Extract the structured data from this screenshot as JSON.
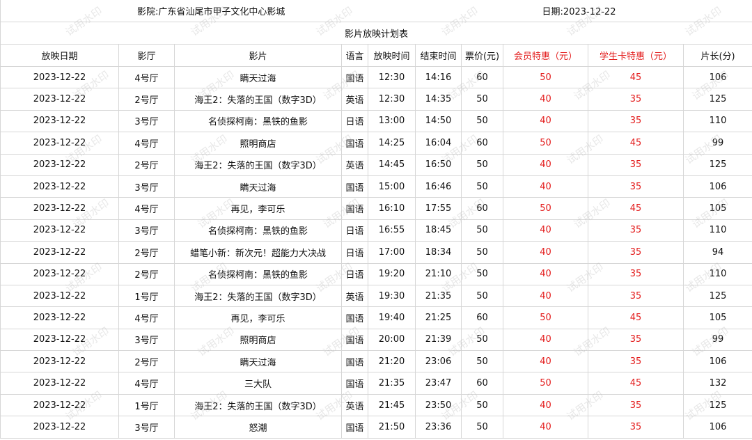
{
  "header": {
    "cinema": "影院:广东省汕尾市甲子文化中心影城",
    "date": "日期:2023-12-22",
    "subtitle": "影片放映计划表"
  },
  "columns": [
    "放映日期",
    "影厅",
    "影片",
    "语言",
    "放映时间",
    "结束时间",
    "票价(元)",
    "会员特惠（元）",
    "学生卡特惠（元）",
    "片长(分)"
  ],
  "highlight_color": "#e31b1b",
  "watermark": "试用水印",
  "rows": [
    [
      "2023-12-22",
      "4号厅",
      "瞒天过海",
      "国语",
      "12:30",
      "14:16",
      "60",
      "50",
      "45",
      "106"
    ],
    [
      "2023-12-22",
      "2号厅",
      "海王2：失落的王国（数字3D）",
      "英语",
      "12:30",
      "14:35",
      "50",
      "40",
      "35",
      "125"
    ],
    [
      "2023-12-22",
      "3号厅",
      "名侦探柯南：黑铁的鱼影",
      "日语",
      "13:00",
      "14:50",
      "50",
      "40",
      "35",
      "110"
    ],
    [
      "2023-12-22",
      "4号厅",
      "照明商店",
      "国语",
      "14:25",
      "16:04",
      "60",
      "50",
      "45",
      "99"
    ],
    [
      "2023-12-22",
      "2号厅",
      "海王2：失落的王国（数字3D）",
      "英语",
      "14:45",
      "16:50",
      "50",
      "40",
      "35",
      "125"
    ],
    [
      "2023-12-22",
      "3号厅",
      "瞒天过海",
      "国语",
      "15:00",
      "16:46",
      "50",
      "40",
      "35",
      "106"
    ],
    [
      "2023-12-22",
      "4号厅",
      "再见，李可乐",
      "国语",
      "16:10",
      "17:55",
      "60",
      "50",
      "45",
      "105"
    ],
    [
      "2023-12-22",
      "3号厅",
      "名侦探柯南：黑铁的鱼影",
      "日语",
      "16:55",
      "18:45",
      "50",
      "40",
      "35",
      "110"
    ],
    [
      "2023-12-22",
      "2号厅",
      "蜡笔小新：新次元！超能力大决战",
      "日语",
      "17:00",
      "18:34",
      "50",
      "40",
      "35",
      "94"
    ],
    [
      "2023-12-22",
      "2号厅",
      "名侦探柯南：黑铁的鱼影",
      "日语",
      "19:20",
      "21:10",
      "50",
      "40",
      "35",
      "110"
    ],
    [
      "2023-12-22",
      "1号厅",
      "海王2：失落的王国（数字3D）",
      "英语",
      "19:30",
      "21:35",
      "50",
      "40",
      "35",
      "125"
    ],
    [
      "2023-12-22",
      "4号厅",
      "再见，李可乐",
      "国语",
      "19:40",
      "21:25",
      "60",
      "50",
      "45",
      "105"
    ],
    [
      "2023-12-22",
      "3号厅",
      "照明商店",
      "国语",
      "20:00",
      "21:39",
      "50",
      "40",
      "35",
      "99"
    ],
    [
      "2023-12-22",
      "2号厅",
      "瞒天过海",
      "国语",
      "21:20",
      "23:06",
      "50",
      "40",
      "35",
      "106"
    ],
    [
      "2023-12-22",
      "4号厅",
      "三大队",
      "国语",
      "21:35",
      "23:47",
      "60",
      "50",
      "45",
      "132"
    ],
    [
      "2023-12-22",
      "1号厅",
      "海王2：失落的王国（数字3D）",
      "英语",
      "21:45",
      "23:50",
      "50",
      "40",
      "35",
      "125"
    ],
    [
      "2023-12-22",
      "3号厅",
      "怒潮",
      "国语",
      "21:50",
      "23:36",
      "50",
      "40",
      "35",
      "106"
    ]
  ]
}
